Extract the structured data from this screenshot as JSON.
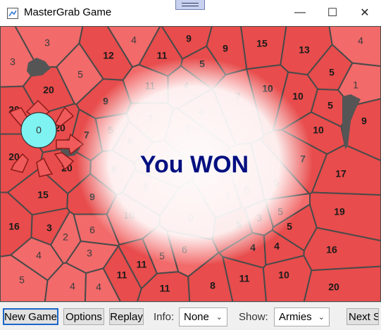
{
  "window": {
    "title": "MasterGrab Game",
    "minimize_glyph": "—",
    "maximize_glyph": "☐",
    "close_glyph": "✕"
  },
  "board": {
    "result_text": "You WON",
    "player_army": "0",
    "colors": {
      "enemy": "#f26a6a",
      "enemy_dark": "#e84c4c",
      "border": "#4a4a4a",
      "player": "#7ff2f2",
      "win_text": "#000f80"
    },
    "regions": [
      {
        "t": "3",
        "b": 0
      },
      {
        "t": "4",
        "b": 0
      },
      {
        "t": "9",
        "b": 1
      },
      {
        "t": "11",
        "b": 1
      },
      {
        "t": "9",
        "b": 1
      },
      {
        "t": "15",
        "b": 1
      },
      {
        "t": "13",
        "b": 1
      },
      {
        "t": "4",
        "b": 0
      },
      {
        "t": "3",
        "b": 0
      },
      {
        "t": "12",
        "b": 1
      },
      {
        "t": "5",
        "b": 0
      },
      {
        "t": "5",
        "b": 1
      },
      {
        "t": "20",
        "b": 1
      },
      {
        "t": "11",
        "b": 0
      },
      {
        "t": "4",
        "b": 0
      },
      {
        "t": "7",
        "b": 0
      },
      {
        "t": "10",
        "b": 1
      },
      {
        "t": "5",
        "b": 1
      },
      {
        "t": "1",
        "b": 0
      },
      {
        "t": "20",
        "b": 1
      },
      {
        "t": "9",
        "b": 1
      },
      {
        "t": "10",
        "b": 1
      },
      {
        "t": "5",
        "b": 1
      },
      {
        "t": "20",
        "b": 1
      },
      {
        "t": "7",
        "b": 1
      },
      {
        "t": "5",
        "b": 0
      },
      {
        "t": "7",
        "b": 0
      },
      {
        "t": "4",
        "b": 0
      },
      {
        "t": "10",
        "b": 1
      },
      {
        "t": "9",
        "b": 1
      },
      {
        "t": "20",
        "b": 1
      },
      {
        "t": "6",
        "b": 0
      },
      {
        "t": "5",
        "b": 0
      },
      {
        "t": "20",
        "b": 1
      },
      {
        "t": "8",
        "b": 0
      },
      {
        "t": "5",
        "b": 0
      },
      {
        "t": "7",
        "b": 1
      },
      {
        "t": "17",
        "b": 1
      },
      {
        "t": "15",
        "b": 1
      },
      {
        "t": "9",
        "b": 1
      },
      {
        "t": "6",
        "b": 0
      },
      {
        "t": "6",
        "b": 0
      },
      {
        "t": "5",
        "b": 0
      },
      {
        "t": "16",
        "b": 1
      },
      {
        "t": "3",
        "b": 1
      },
      {
        "t": "6",
        "b": 0
      },
      {
        "t": "10",
        "b": 0
      },
      {
        "t": "7",
        "b": 0
      },
      {
        "t": "5",
        "b": 0
      },
      {
        "t": "3",
        "b": 0
      },
      {
        "t": "5",
        "b": 1
      },
      {
        "t": "19",
        "b": 1
      },
      {
        "t": "2",
        "b": 0
      },
      {
        "t": "0",
        "b": 0
      },
      {
        "t": "5",
        "b": 1
      },
      {
        "t": "4",
        "b": 0
      },
      {
        "t": "3",
        "b": 0
      },
      {
        "t": "5",
        "b": 0
      },
      {
        "t": "6",
        "b": 0
      },
      {
        "t": "4",
        "b": 1
      },
      {
        "t": "4",
        "b": 1
      },
      {
        "t": "16",
        "b": 1
      },
      {
        "t": "5",
        "b": 0
      },
      {
        "t": "4",
        "b": 0
      },
      {
        "t": "4",
        "b": 0
      },
      {
        "t": "11",
        "b": 1
      },
      {
        "t": "11",
        "b": 1
      },
      {
        "t": "8",
        "b": 1
      },
      {
        "t": "11",
        "b": 1
      },
      {
        "t": "10",
        "b": 1
      },
      {
        "t": "20",
        "b": 1
      },
      {
        "t": "11",
        "b": 1
      }
    ]
  },
  "toolbar": {
    "new_game": "New Game",
    "options": "Options",
    "replay": "Replay",
    "info_label": "Info:",
    "info_value": "None",
    "show_label": "Show:",
    "show_value": "Armies",
    "next_step": "Next S",
    "chevron": "⌄"
  }
}
